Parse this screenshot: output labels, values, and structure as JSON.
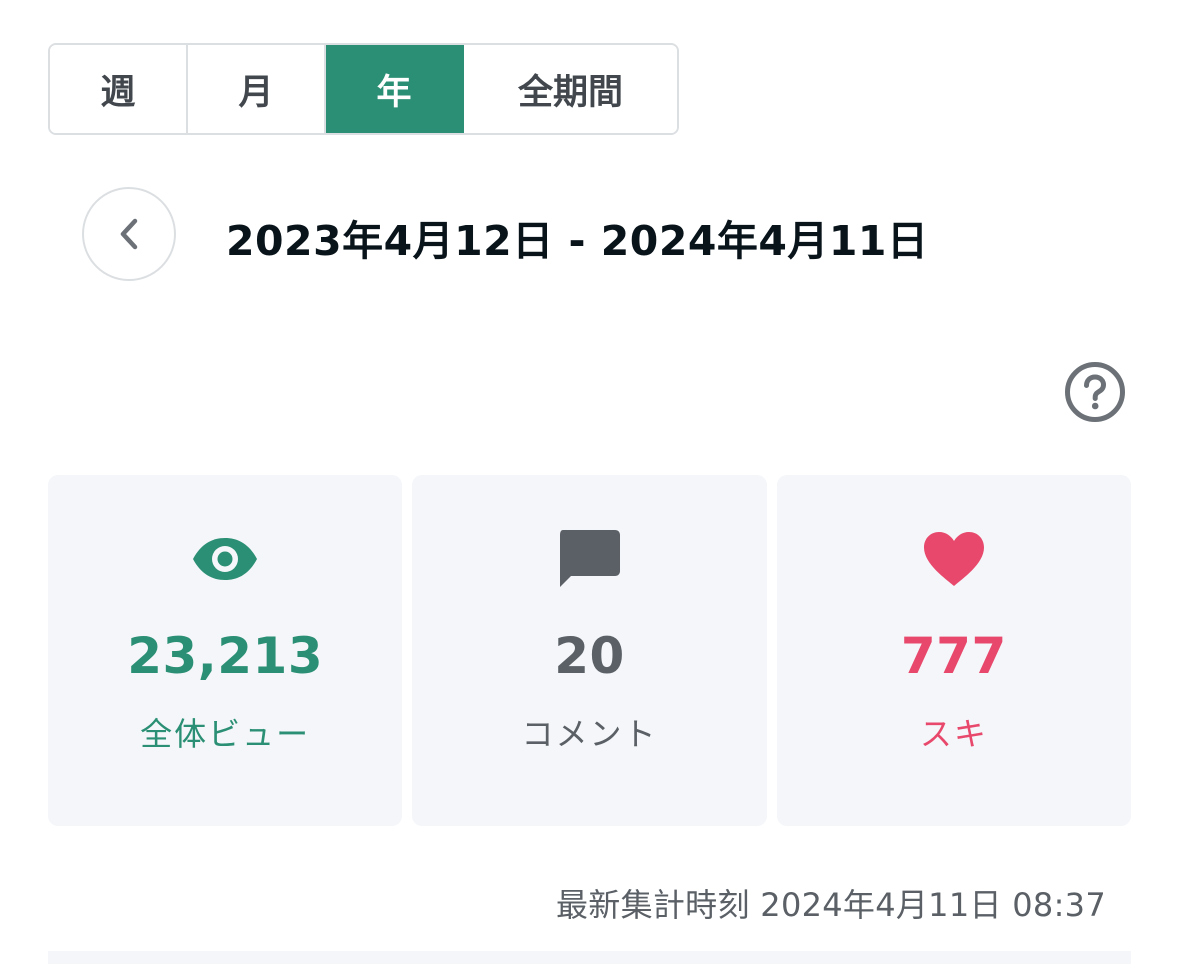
{
  "period_tabs": [
    {
      "label": "週",
      "active": false
    },
    {
      "label": "月",
      "active": false
    },
    {
      "label": "年",
      "active": true
    },
    {
      "label": "全期間",
      "active": false
    }
  ],
  "date_range": {
    "text": "2023年4月12日 - 2024年4月11日",
    "back_icon": "chevron-left-icon"
  },
  "help": {
    "icon": "question-circle-icon"
  },
  "stats": [
    {
      "icon": "eye-icon",
      "value": "23,213",
      "label": "全体ビュー",
      "color": "#2a8f74"
    },
    {
      "icon": "comment-icon",
      "value": "20",
      "label": "コメント",
      "color": "#5a6066"
    },
    {
      "icon": "heart-icon",
      "value": "777",
      "label": "スキ",
      "color": "#e8486b"
    }
  ],
  "last_updated": {
    "label": "最新集計時刻",
    "value": "2024年4月11日 08:37"
  },
  "colors": {
    "accent": "#2a8f74",
    "like": "#e8486b",
    "text": "#08131a",
    "muted": "#5a6066",
    "card_bg": "#f4f6f9",
    "border": "#dcdfe2"
  }
}
